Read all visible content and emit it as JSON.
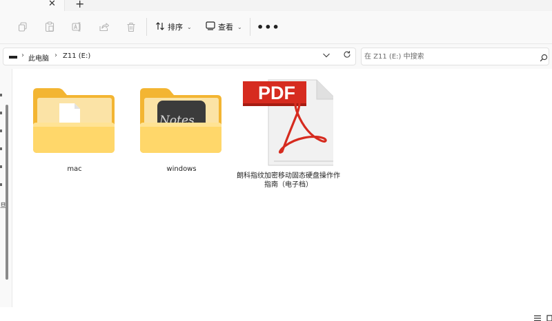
{
  "tabs": {
    "close_label": "✕",
    "new_tab_label": "+"
  },
  "toolbar": {
    "icons": [
      "copy-icon",
      "paste-icon",
      "rename-icon",
      "share-icon",
      "delete-icon"
    ],
    "sort_label": "排序",
    "view_label": "查看",
    "more_label": "•••"
  },
  "address": {
    "crumbs": [
      "此电脑",
      "Z11 (E:)"
    ],
    "search_placeholder": "在 Z11 (E:) 中搜索"
  },
  "items": [
    {
      "name": "mac",
      "type": "folder"
    },
    {
      "name": "windows",
      "type": "folder"
    },
    {
      "name": "朗科指纹加密移动固态硬盘操作指南（电子档）",
      "name_line1": "朗科指纹加密移动固态硬盘操作作",
      "name_line2": "指南（电子档）",
      "type": "pdf",
      "badge": "PDF"
    }
  ],
  "navpane": {
    "glyph": "旦"
  },
  "colors": {
    "folder_back": "#f3b532",
    "folder_front": "#ffd76a",
    "pdf_red": "#d62b1f",
    "accent": "#0067c0"
  }
}
